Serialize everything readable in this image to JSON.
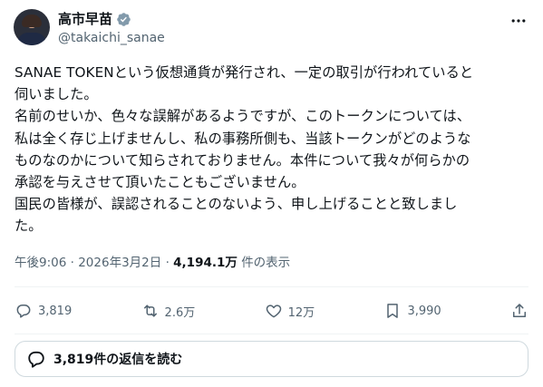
{
  "author": {
    "name": "高市早苗",
    "handle": "@takaichi_sanae"
  },
  "tweet": {
    "text": "SANAE TOKENという仮想通貨が発行され、一定の取引が行われていると\n伺いました。\n名前のせいか、色々な誤解があるようですが、このトークンについては、\n私は全く存じ上げませんし、私の事務所側も、当該トークンがどのような\nものなのかについて知らされておりません。本件について我々が何らかの\n承認を与えさせて頂いたこともございません。\n国民の皆様が、誤認されることのないよう、申し上げることと致しまし\nた。",
    "time": "午後9:06",
    "separator": "·",
    "date": "2026年3月2日",
    "views_count": "4,194.1万",
    "views_label": "件の表示"
  },
  "actions": {
    "reply": "3,819",
    "retweet": "2.6万",
    "like": "12万",
    "bookmark": "3,990"
  },
  "read_replies": "3,819件の返信を読む",
  "colors": {
    "text": "#0f1419",
    "secondary": "#536471",
    "verified": "#829aab",
    "border": "#cfd9de"
  }
}
